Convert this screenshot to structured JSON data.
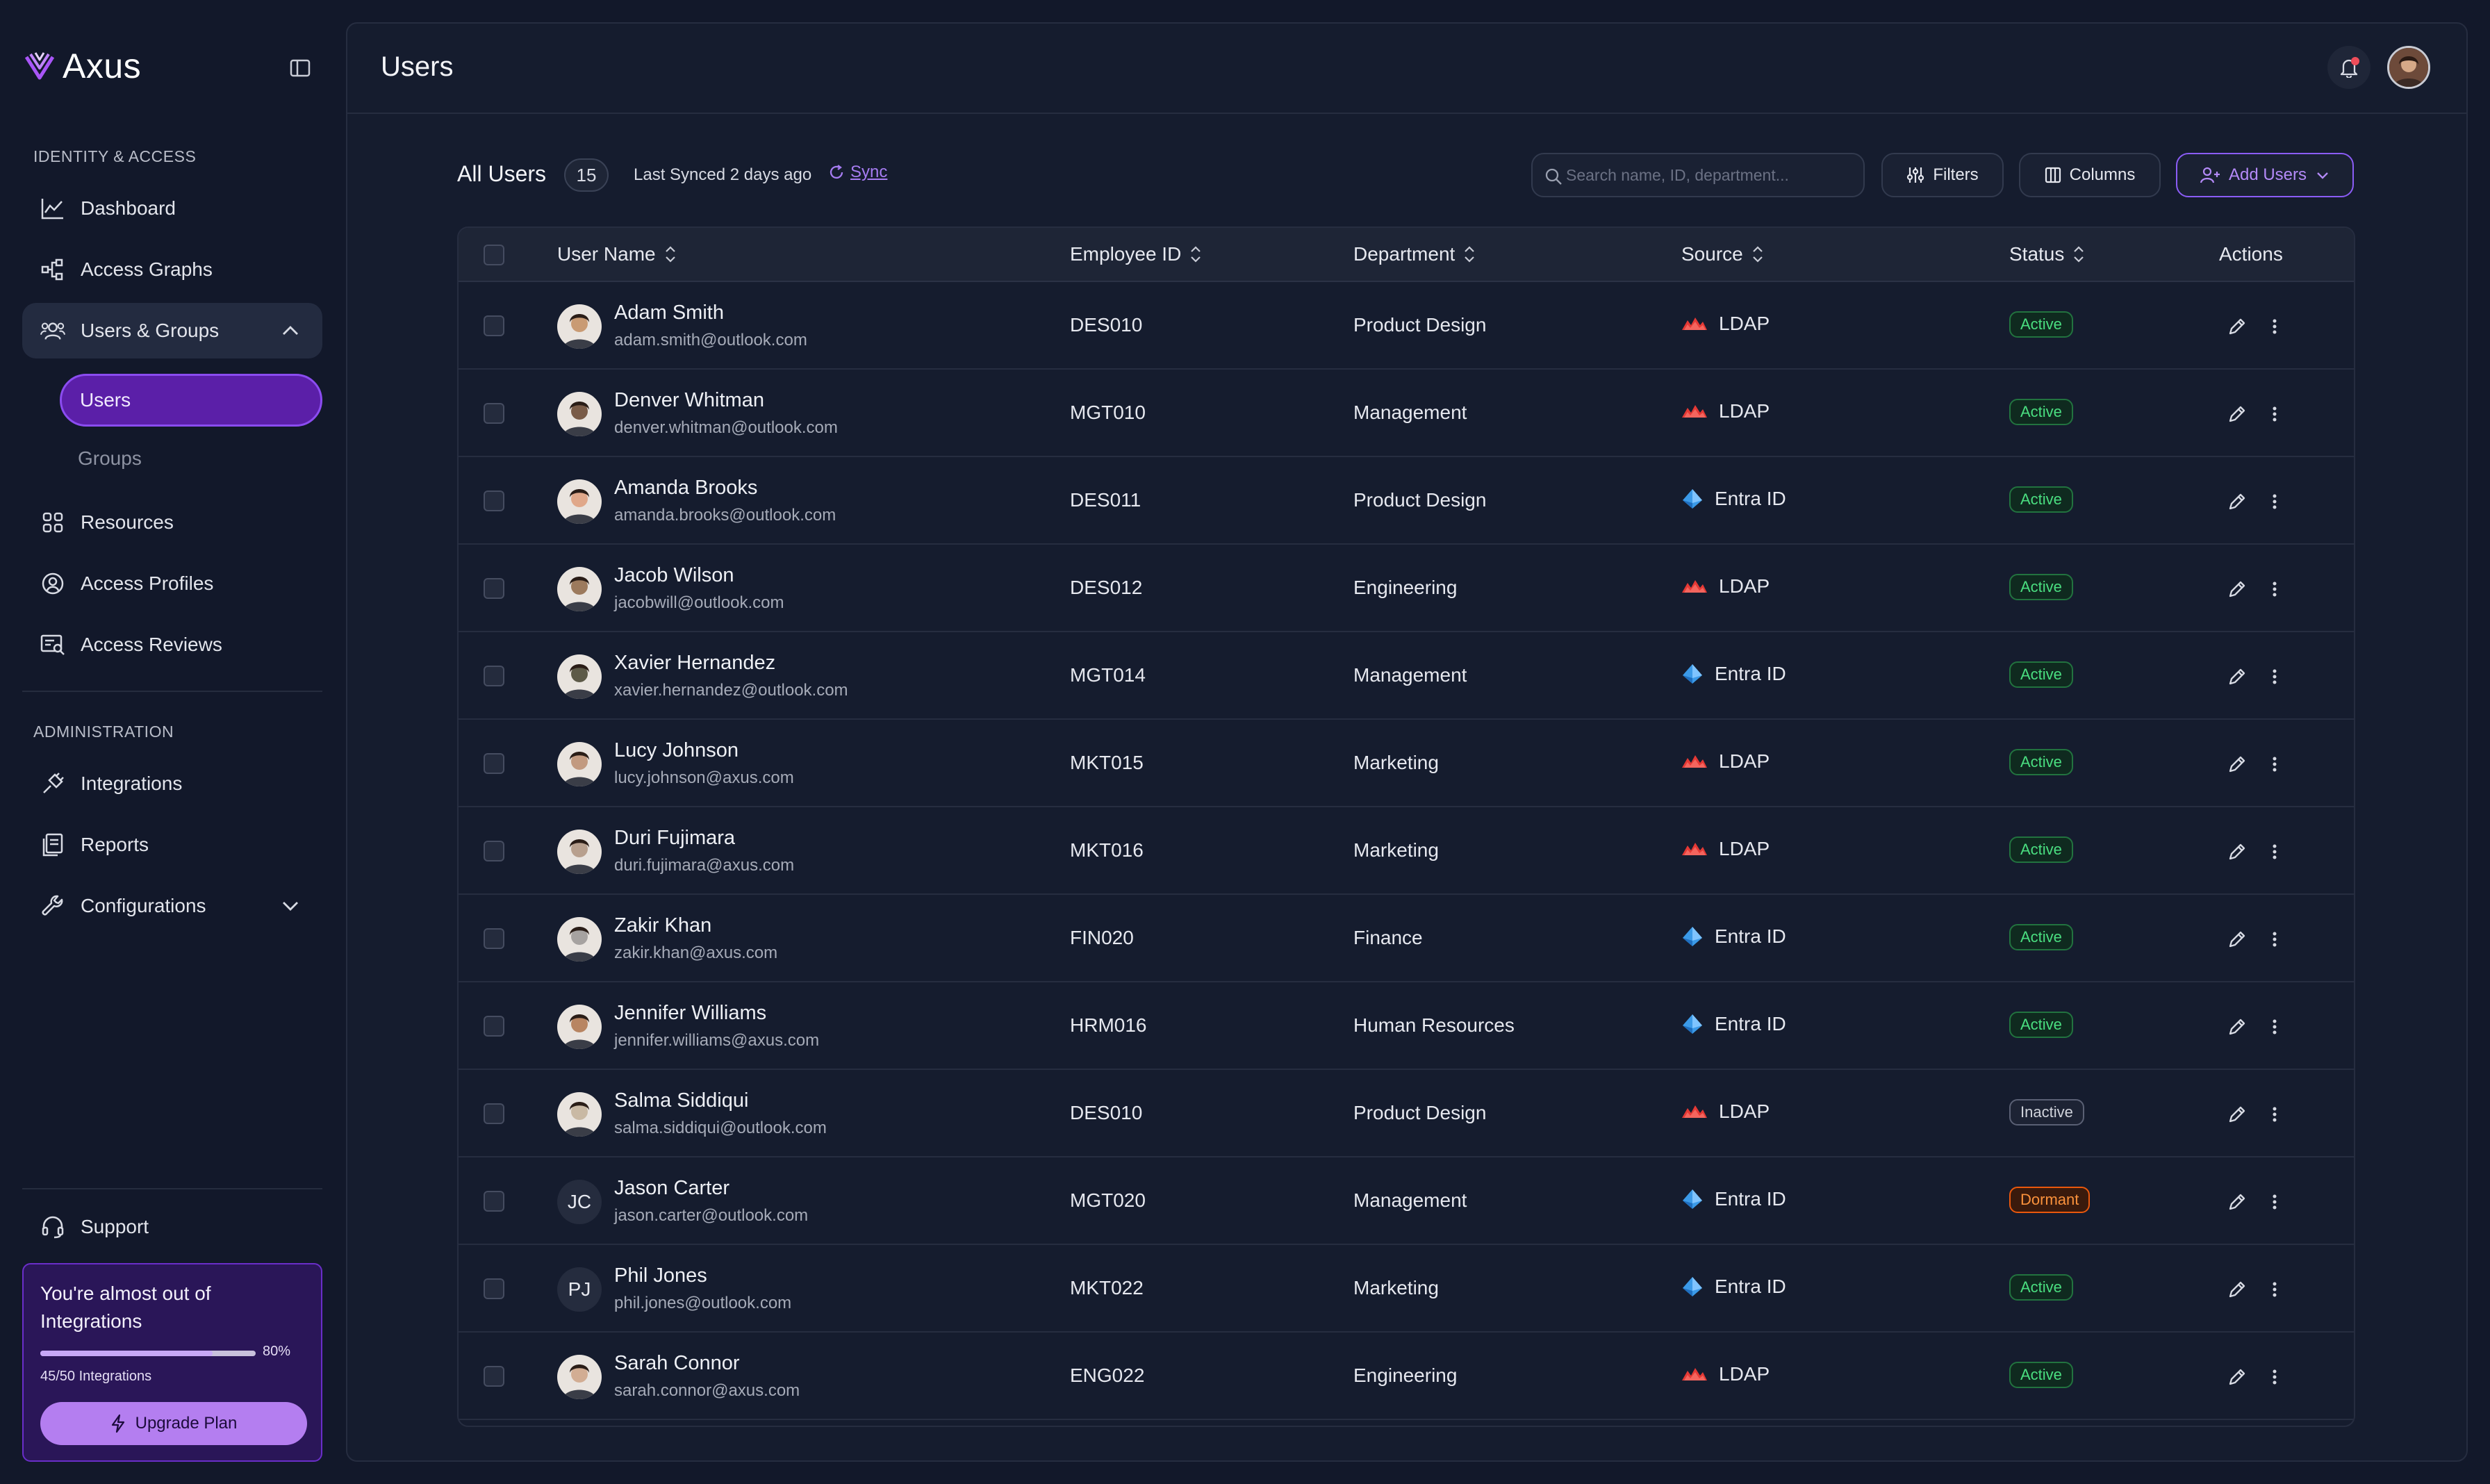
{
  "brand": {
    "name": "Axus",
    "accent": "#a855f7"
  },
  "sidebar": {
    "section_identity": "IDENTITY & ACCESS",
    "items_identity": [
      {
        "label": "Dashboard",
        "icon": "chart-line-icon"
      },
      {
        "label": "Access Graphs",
        "icon": "graph-nodes-icon"
      },
      {
        "label": "Users & Groups",
        "icon": "users-icon",
        "expanded": true
      },
      {
        "label": "Resources",
        "icon": "grid-icon"
      },
      {
        "label": "Access Profiles",
        "icon": "profile-badge-icon"
      },
      {
        "label": "Access Reviews",
        "icon": "review-icon"
      }
    ],
    "sub_items": [
      {
        "label": "Users",
        "active": true
      },
      {
        "label": "Groups",
        "active": false
      }
    ],
    "section_admin": "ADMINISTRATION",
    "items_admin": [
      {
        "label": "Integrations",
        "icon": "plug-icon"
      },
      {
        "label": "Reports",
        "icon": "report-icon"
      },
      {
        "label": "Configurations",
        "icon": "wrench-icon"
      }
    ],
    "support_label": "Support",
    "upgrade": {
      "title": "You're almost out of Integrations",
      "percent_label": "80%",
      "progress": 0.8,
      "usage": "45/50 Integrations",
      "button": "Upgrade Plan"
    }
  },
  "header": {
    "title": "Users"
  },
  "toolbar": {
    "title": "All Users",
    "count": "15",
    "synced": "Last Synced 2 days ago",
    "sync_label": "Sync",
    "search_placeholder": "Search name, ID, department...",
    "filters_label": "Filters",
    "columns_label": "Columns",
    "add_users_label": "Add Users"
  },
  "table": {
    "columns": {
      "user_name": "User Name",
      "employee_id": "Employee ID",
      "department": "Department",
      "source": "Source",
      "status": "Status",
      "actions": "Actions"
    },
    "rows": [
      {
        "name": "Adam Smith",
        "email": "adam.smith@outlook.com",
        "emp_id": "DES010",
        "department": "Product Design",
        "source": "LDAP",
        "status": "Active",
        "avatar": "photo",
        "tone": "#c99b74"
      },
      {
        "name": "Denver Whitman",
        "email": "denver.whitman@outlook.com",
        "emp_id": "MGT010",
        "department": "Management",
        "source": "LDAP",
        "status": "Active",
        "avatar": "photo",
        "tone": "#7a5c48"
      },
      {
        "name": "Amanda Brooks",
        "email": "amanda.brooks@outlook.com",
        "emp_id": "DES011",
        "department": "Product Design",
        "source": "Entra ID",
        "status": "Active",
        "avatar": "photo",
        "tone": "#e0a88a"
      },
      {
        "name": "Jacob Wilson",
        "email": "jacobwill@outlook.com",
        "emp_id": "DES012",
        "department": "Engineering",
        "source": "LDAP",
        "status": "Active",
        "avatar": "photo",
        "tone": "#9c7a5d"
      },
      {
        "name": "Xavier Hernandez",
        "email": "xavier.hernandez@outlook.com",
        "emp_id": "MGT014",
        "department": "Management",
        "source": "Entra ID",
        "status": "Active",
        "avatar": "photo",
        "tone": "#5d5a48"
      },
      {
        "name": "Lucy Johnson",
        "email": "lucy.johnson@axus.com",
        "emp_id": "MKT015",
        "department": "Marketing",
        "source": "LDAP",
        "status": "Active",
        "avatar": "photo",
        "tone": "#c29a80"
      },
      {
        "name": "Duri Fujimara",
        "email": "duri.fujimara@axus.com",
        "emp_id": "MKT016",
        "department": "Marketing",
        "source": "LDAP",
        "status": "Active",
        "avatar": "photo",
        "tone": "#b8a08e"
      },
      {
        "name": "Zakir Khan",
        "email": "zakir.khan@axus.com",
        "emp_id": "FIN020",
        "department": "Finance",
        "source": "Entra ID",
        "status": "Active",
        "avatar": "photo",
        "tone": "#a6a2a0"
      },
      {
        "name": "Jennifer Williams",
        "email": "jennifer.williams@axus.com",
        "emp_id": "HRM016",
        "department": "Human Resources",
        "source": "Entra ID",
        "status": "Active",
        "avatar": "photo",
        "tone": "#b88562"
      },
      {
        "name": "Salma Siddiqui",
        "email": "salma.siddiqui@outlook.com",
        "emp_id": "DES010",
        "department": "Product Design",
        "source": "LDAP",
        "status": "Inactive",
        "avatar": "photo",
        "tone": "#c9b9a4"
      },
      {
        "name": "Jason Carter",
        "email": "jason.carter@outlook.com",
        "emp_id": "MGT020",
        "department": "Management",
        "source": "Entra ID",
        "status": "Dormant",
        "avatar": "JC",
        "tone": ""
      },
      {
        "name": "Phil Jones",
        "email": "phil.jones@outlook.com",
        "emp_id": "MKT022",
        "department": "Marketing",
        "source": "Entra ID",
        "status": "Active",
        "avatar": "PJ",
        "tone": ""
      },
      {
        "name": "Sarah Connor",
        "email": "sarah.connor@axus.com",
        "emp_id": "ENG022",
        "department": "Engineering",
        "source": "LDAP",
        "status": "Active",
        "avatar": "photo",
        "tone": "#d2ad93"
      }
    ]
  },
  "colors": {
    "ldap": "#e53935",
    "entra": "#3b9ae8",
    "active": "#4ade80",
    "dormant": "#fb923c"
  }
}
